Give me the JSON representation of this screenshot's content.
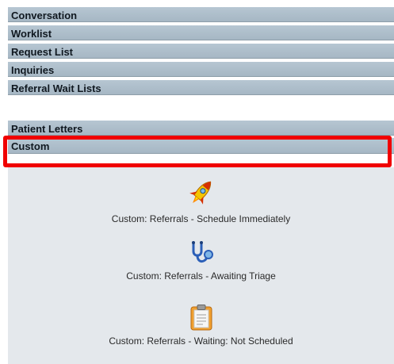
{
  "sections": {
    "conversation": "Conversation",
    "worklist": "Worklist",
    "request_list": "Request List",
    "inquiries": "Inquiries",
    "referral_wait_lists": "Referral Wait Lists",
    "patient_letters": "Patient Letters",
    "custom": "Custom"
  },
  "custom_items": [
    {
      "label": "Custom: Referrals - Schedule Immediately",
      "icon": "rocket-icon"
    },
    {
      "label": "Custom: Referrals - Awaiting Triage",
      "icon": "stethoscope-icon"
    },
    {
      "label": "Custom: Referrals - Waiting: Not Scheduled",
      "icon": "clipboard-icon"
    }
  ],
  "colors": {
    "header_bg": "#aebecb",
    "content_bg": "#e4e8ec",
    "highlight": "#f00000"
  }
}
